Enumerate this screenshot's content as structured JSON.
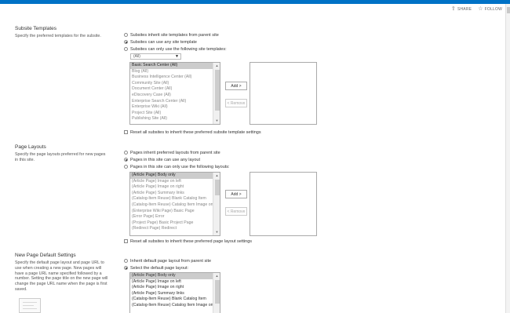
{
  "header": {
    "share_label": "SHARE",
    "follow_label": "FOLLOW",
    "share_icon": "share-icon",
    "follow_icon": "star-icon",
    "accent_color": "#0072c6"
  },
  "subsite_templates": {
    "title": "Subsite Templates",
    "description": "Specify the preferred templates for the subsite.",
    "options": [
      "Subsites inherit site templates from parent site",
      "Subsites can use any site template",
      "Subsites can only use the following site templates:"
    ],
    "selected_option": 1,
    "filter_value": "(All)",
    "available_items": [
      "Basic Search Center (All)",
      "Blog (All)",
      "Business Intelligence Center (All)",
      "Community Site (All)",
      "Document Center (All)",
      "eDiscovery Case (All)",
      "Enterprise Search Center (All)",
      "Enterprise Wiki (All)",
      "Project Site (All)",
      "Publishing Site (All)"
    ],
    "add_button": "Add >",
    "remove_button": "< Remove",
    "reset_checkbox": "Reset all subsites to inherit these preferred subsite template settings"
  },
  "page_layouts": {
    "title": "Page Layouts",
    "description": "Specify the page layouts preferred for new pages in this site.",
    "options": [
      "Pages inherit preferred layouts from parent site",
      "Pages in this site can use any layout",
      "Pages in this site can only use the following layouts:"
    ],
    "selected_option": 1,
    "available_items": [
      "(Article Page) Body only",
      "(Article Page) Image on left",
      "(Article Page) Image on right",
      "(Article Page) Summary links",
      "(Catalog-Item Reuse) Blank Catalog Item",
      "(Catalog-Item Reuse) Catalog Item Image on",
      "(Enterprise Wiki Page) Basic Page",
      "(Error Page) Error",
      "(Project Page) Basic Project Page",
      "(Redirect Page) Redirect"
    ],
    "add_button": "Add >",
    "remove_button": "< Remove",
    "reset_checkbox": "Reset all subsites to inherit these preferred page layout settings"
  },
  "new_page_defaults": {
    "title": "New Page Default Settings",
    "description": "Specify the default page layout and page URL to use when creating a new page. New pages will have a page URL name specified followed by a number. Setting the page title on the new page will change the page URL name when the page is first saved.",
    "options": [
      "Inherit default page layout from parent site",
      "Select the default page layout:"
    ],
    "selected_option": 1,
    "layout_items": [
      "(Article Page) Body only",
      "(Article Page) Image on left",
      "(Article Page) Image on right",
      "(Article Page) Summary links",
      "(Catalog-Item Reuse) Blank Catalog Item",
      "(Catalog-Item Reuse) Catalog Item Image on Left"
    ]
  }
}
